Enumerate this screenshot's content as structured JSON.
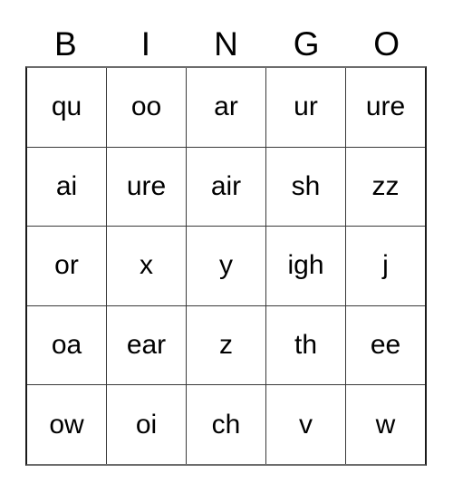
{
  "card": {
    "title": "BINGO",
    "columns": 5,
    "rows": 5,
    "text_color": "#000000",
    "background_color": "#ffffff",
    "border_color": "#1a1a1a",
    "gridline_color": "#3a3a3a"
  },
  "header": {
    "letters": [
      {
        "label": "B"
      },
      {
        "label": "I"
      },
      {
        "label": "N"
      },
      {
        "label": "G"
      },
      {
        "label": "O"
      }
    ]
  },
  "grid": {
    "rows": [
      {
        "cells": [
          {
            "value": "qu"
          },
          {
            "value": "oo"
          },
          {
            "value": "ar"
          },
          {
            "value": "ur"
          },
          {
            "value": "ure"
          }
        ]
      },
      {
        "cells": [
          {
            "value": "ai"
          },
          {
            "value": "ure"
          },
          {
            "value": "air"
          },
          {
            "value": "sh"
          },
          {
            "value": "zz"
          }
        ]
      },
      {
        "cells": [
          {
            "value": "or"
          },
          {
            "value": "x"
          },
          {
            "value": "y"
          },
          {
            "value": "igh"
          },
          {
            "value": "j"
          }
        ]
      },
      {
        "cells": [
          {
            "value": "oa"
          },
          {
            "value": "ear"
          },
          {
            "value": "z"
          },
          {
            "value": "th"
          },
          {
            "value": "ee"
          }
        ]
      },
      {
        "cells": [
          {
            "value": "ow"
          },
          {
            "value": "oi"
          },
          {
            "value": "ch"
          },
          {
            "value": "v"
          },
          {
            "value": "w"
          }
        ]
      }
    ]
  }
}
